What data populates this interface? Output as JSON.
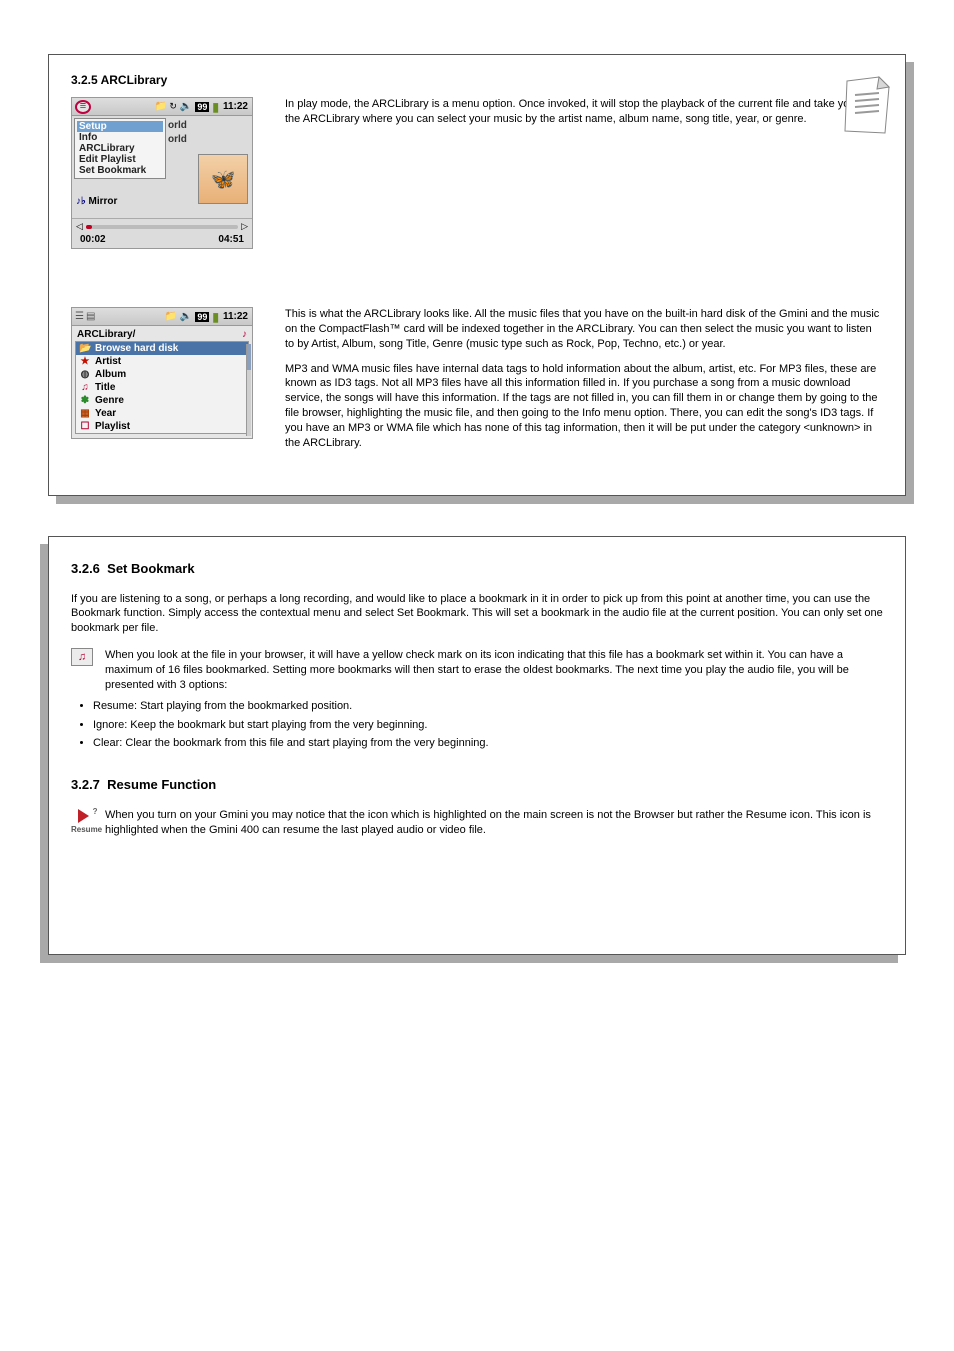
{
  "page1": {
    "top_title": "3.2.5 ARCLibrary",
    "dev1": {
      "bat99": "99",
      "time": "11:22",
      "options": [
        "Setup",
        "Info",
        "ARCLibrary",
        "Edit Playlist",
        "Set Bookmark"
      ],
      "bg1": "orld",
      "bg2": "orld",
      "mirror_prefix": "♪♭",
      "mirror": "Mirror",
      "time_elapsed": "00:02",
      "time_total": "04:51"
    },
    "p1": "In play mode, the ARCLibrary is a menu option. Once invoked, it will stop the playback of the current file and take you to the ARCLibrary where you can select your music by the artist name, album name, song title, year, or genre.",
    "arc": {
      "bat99": "99",
      "time": "11:22",
      "heading": "ARCLibrary/",
      "items": [
        "Browse hard disk",
        "Artist",
        "Album",
        "Title",
        "Genre",
        "Year",
        "Playlist"
      ]
    },
    "arc_p1": "This is what the ARCLibrary looks like. All the music files that you have on the built-in hard disk of the Gmini and the music on the CompactFlash™ card will be indexed together in the ARCLibrary. You can then select the music you want to listen to by Artist, Album, song Title, Genre (music type such as Rock, Pop, Techno, etc.) or year.",
    "arc_p2": "MP3 and WMA music files have internal data tags to hold information about the album, artist, etc. For MP3 files, these are known as ID3 tags. Not all MP3 files have all this information filled in. If you purchase a song from a music download service, the songs will have this information. If the tags are not filled in, you can fill them in or change them by going to the file browser, highlighting the music file, and then going to the Info menu option. There, you can edit the song's ID3 tags. If you have an MP3 or WMA file which has none of this tag information, then it will be put under the category <unknown> in the ARCLibrary."
  },
  "page2": {
    "heading_no": "3.2.6",
    "heading_txt": "Set Bookmark",
    "p1": "If you are listening to a song, or perhaps a long recording, and would like to place a bookmark in it in order to pick up from this point at another time, you can use the Bookmark function. Simply access the contextual menu and select Set Bookmark. This will set a bookmark in the audio file at the current position. You can only set one bookmark per file.",
    "p2": "When you look at the file in your browser, it will have a yellow check mark on its icon indicating that this file has a bookmark set within it. You can have a maximum of 16 files bookmarked. Setting more bookmarks will then start to erase the oldest bookmarks. The next time you play the audio file, you will be presented with 3 options:",
    "opts": [
      "Resume: Start playing from the bookmarked position.",
      "Ignore: Keep the bookmark but start playing from the very beginning.",
      "Clear: Clear the bookmark from this file and start playing from the very beginning."
    ],
    "resume_head_no": "3.2.7",
    "resume_head_txt": "Resume Function",
    "resume_label": "Resume",
    "resume_p": "When you turn on your Gmini you may notice that the icon which is highlighted on the main screen is not the Browser but rather the Resume icon. This icon is highlighted when the Gmini 400 can resume the last played audio or video file."
  }
}
